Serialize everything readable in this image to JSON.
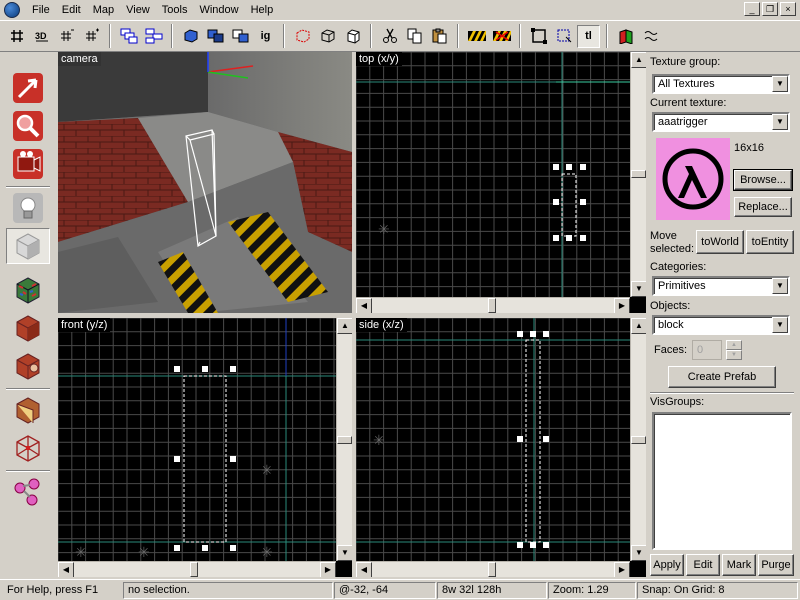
{
  "menu": {
    "items": [
      "File",
      "Edit",
      "Map",
      "View",
      "Tools",
      "Window",
      "Help"
    ]
  },
  "toolbar": {
    "buttons": [
      "grid-toggle",
      "3d-grid",
      "grid-smaller",
      "grid-larger",
      "group",
      "ungroup",
      "carve",
      "hide",
      "hide-others",
      "ignore-groups",
      "select-by-handle",
      "cordon",
      "load-pointfile",
      "cut",
      "copy",
      "paste",
      "toggle-texture-lock",
      "toggle-cordon",
      "zoom-box",
      "select-box",
      "texture-lock",
      "vertex"
    ],
    "ig_label": "ig",
    "tl_label": "tl"
  },
  "left_tools": [
    "selection",
    "magnify",
    "camera",
    "entity",
    "block",
    "texture",
    "apply-decal",
    "face-edit",
    "clip",
    "vertex-manipulation",
    "path"
  ],
  "viewports": {
    "camera": {
      "label": "camera"
    },
    "top": {
      "label": "top (x/y)"
    },
    "front": {
      "label": "front (y/z)"
    },
    "side": {
      "label": "side (x/z)"
    }
  },
  "panel": {
    "texture_group_label": "Texture group:",
    "texture_group_value": "All Textures",
    "current_texture_label": "Current texture:",
    "current_texture_value": "aaatrigger",
    "texture_size": "16x16",
    "browse_label": "Browse...",
    "replace_label": "Replace...",
    "move_selected_label_1": "Move",
    "move_selected_label_2": "selected:",
    "to_world_label": "toWorld",
    "to_entity_label": "toEntity",
    "categories_label": "Categories:",
    "categories_value": "Primitives",
    "objects_label": "Objects:",
    "objects_value": "block",
    "faces_label": "Faces:",
    "faces_value": "0",
    "create_prefab_label": "Create Prefab",
    "visgroups_label": "VisGroups:",
    "apply_label": "Apply",
    "edit_label": "Edit",
    "mark_label": "Mark",
    "purge_label": "Purge"
  },
  "status": {
    "help": "For Help, press F1",
    "selection": "no selection.",
    "coords": "@-32, -64",
    "size": "8w 32l 128h",
    "zoom": "Zoom: 1.29",
    "snap": "Snap: On Grid: 8"
  },
  "colors": {
    "grid": "#4a4a4a",
    "grid_major": "#6a6a6a",
    "axis": "#2a8a7a",
    "selection": "#ffffff",
    "texture_bg": "#f090e0"
  }
}
